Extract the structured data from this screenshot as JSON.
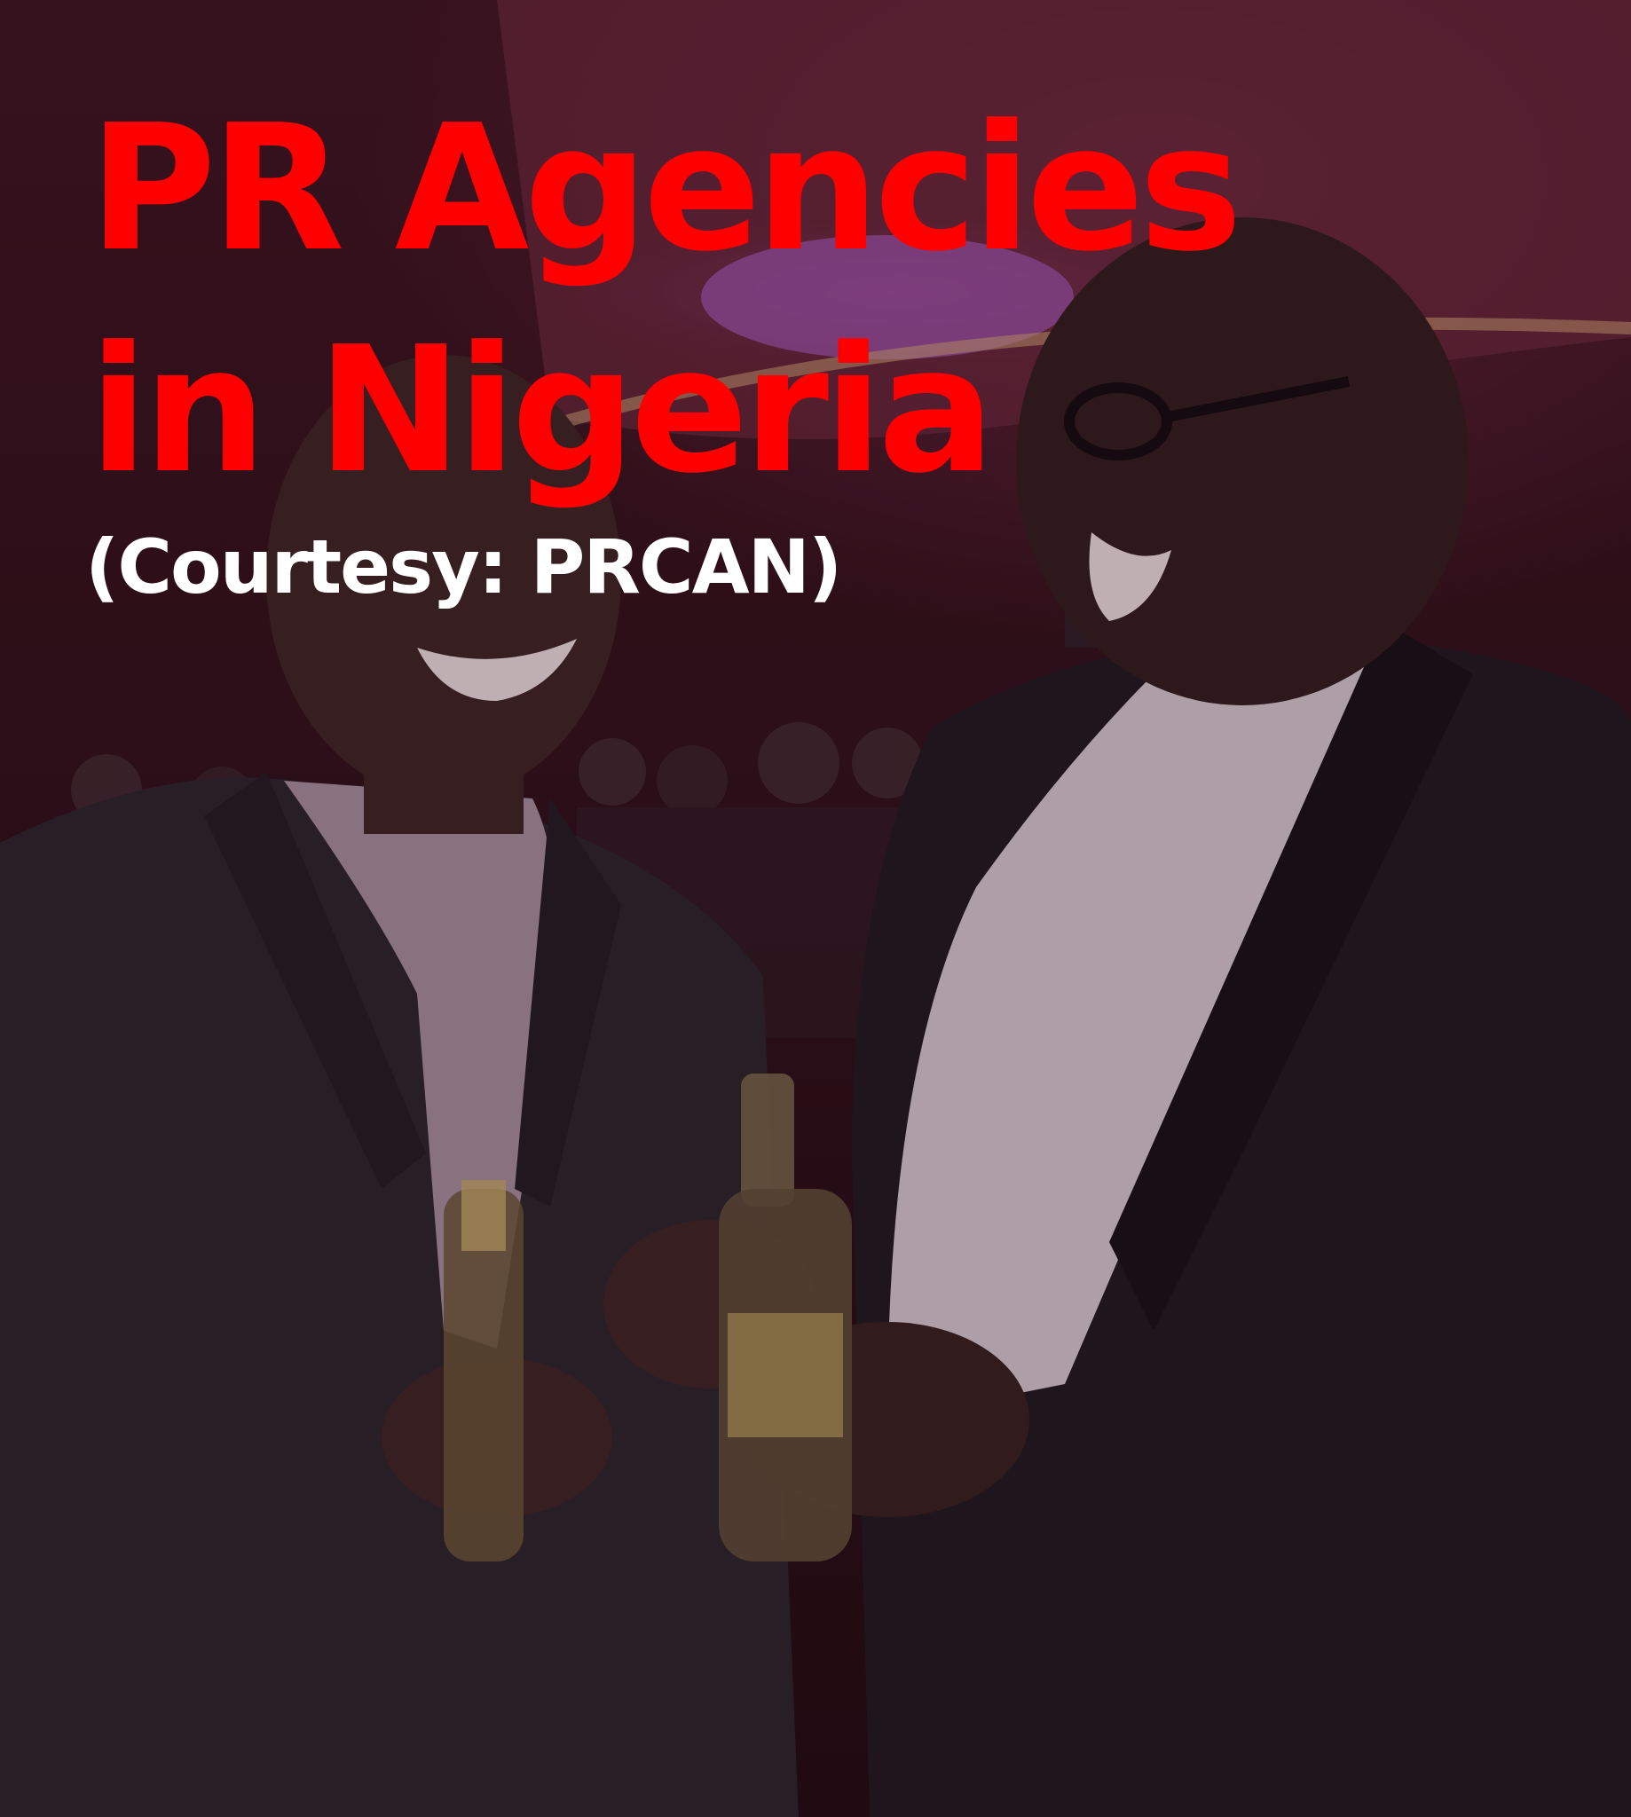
{
  "title": {
    "line1": "PR Agencies",
    "line2": "in Nigeria",
    "color": "#ff0000"
  },
  "credit": {
    "text": "(Courtesy: PRCAN)",
    "color": "#ffffff"
  },
  "photo": {
    "subject": "two-men-laughing-holding-beer-bottles",
    "tint": "#3a1420"
  }
}
